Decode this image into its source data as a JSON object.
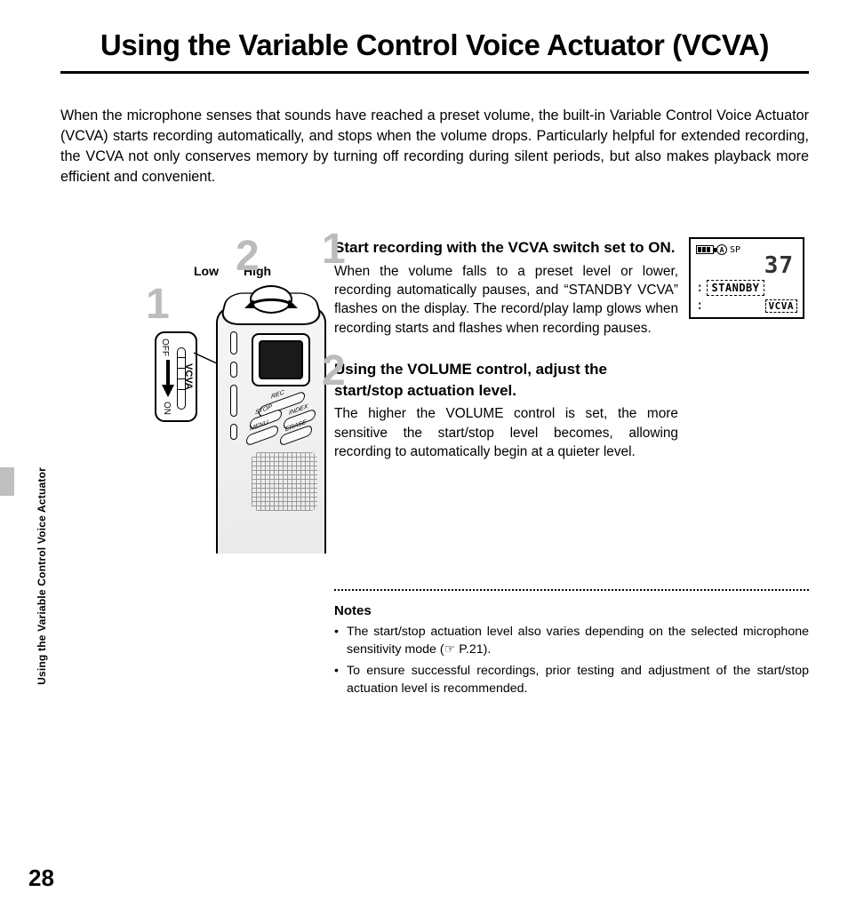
{
  "title": "Using the Variable Control Voice Actuator (VCVA)",
  "intro": "When the microphone senses that sounds have reached a preset volume, the built-in Variable Control Voice Actuator (VCVA) starts recording automatically, and stops when the volume drops. Particularly helpful for extended recording, the VCVA not only conserves memory by turning off recording during silent periods, but also makes playback more efficient and convenient.",
  "device": {
    "low": "Low",
    "high": "High",
    "callout1": "1",
    "callout2": "2",
    "switch_label": "VCVA",
    "switch_off": "OFF",
    "switch_on": "ON",
    "btn_rec": "REC",
    "btn_stop": "STOP",
    "btn_index": "INDEX",
    "btn_menu": "MENU",
    "btn_erase": "ERASE"
  },
  "steps": [
    {
      "num": "1",
      "title": "Start recording with the VCVA switch set to ON.",
      "body": "When the volume falls to a preset level or lower, recording automatically pauses, and “STANDBY VCVA” flashes on the display. The record/play lamp glows when recording starts and flashes when recording pauses."
    },
    {
      "num": "2",
      "title": "Using the VOLUME control, adjust the start/stop actuation level.",
      "body": "The higher the VOLUME control is set, the more sensitive the start/stop level becomes, allowing recording to automatically begin at a quieter level."
    }
  ],
  "notes_heading": "Notes",
  "notes": [
    "The start/stop actuation level also varies depending on the selected microphone sensitivity mode (☞ P.21).",
    "To ensure successful recordings, prior testing and adjustment of the start/stop actuation level is recommended."
  ],
  "lcd": {
    "folder": "A",
    "mode": "SP",
    "file_no": "37",
    "status": "STANDBY",
    "indicator": "VCVA"
  },
  "side_tab": "Using the Variable Control Voice Actuator",
  "page_number": "28"
}
